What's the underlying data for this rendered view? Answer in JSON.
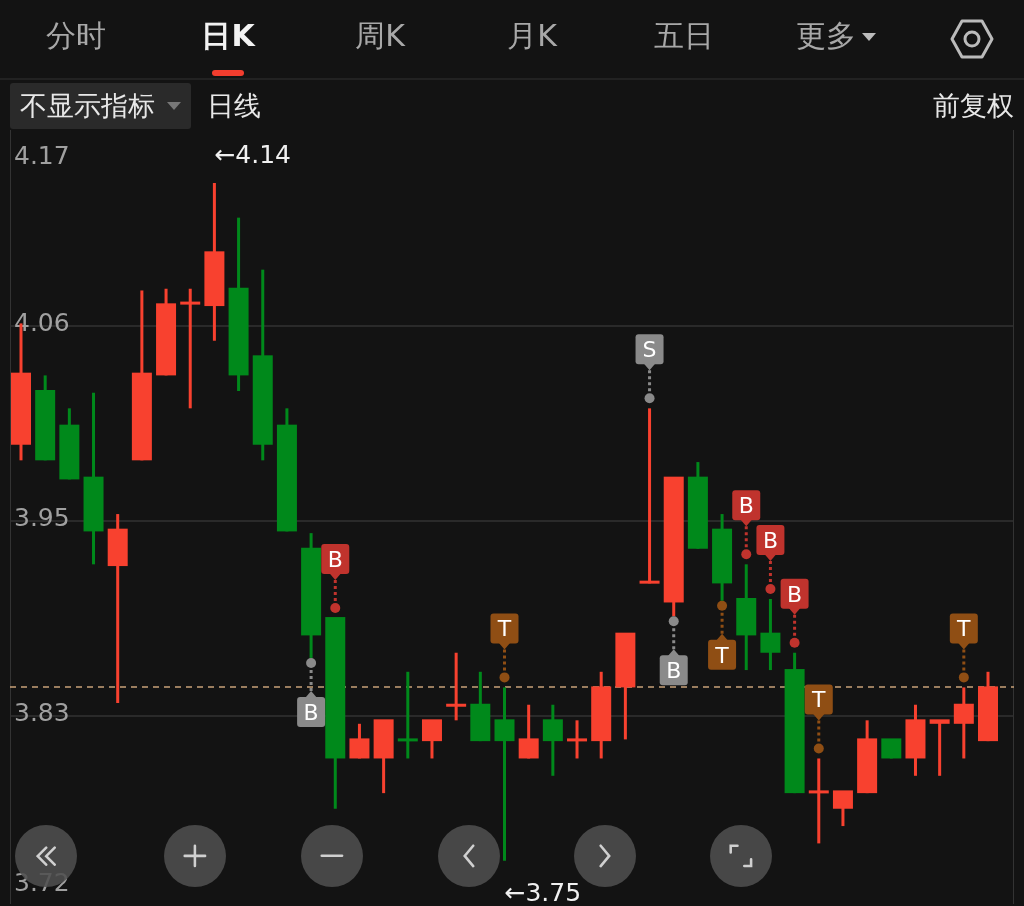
{
  "tabs": [
    {
      "label": "分时",
      "selected": false,
      "kind": "tab"
    },
    {
      "label": "日K",
      "selected": true,
      "kind": "tab"
    },
    {
      "label": "周K",
      "selected": false,
      "kind": "tab"
    },
    {
      "label": "月K",
      "selected": false,
      "kind": "tab"
    },
    {
      "label": "五日",
      "selected": false,
      "kind": "tab"
    },
    {
      "label": "更多",
      "selected": false,
      "kind": "menu"
    }
  ],
  "toolbar": {
    "indicator": "不显示指标",
    "period": "日线",
    "adjustment": "前复权"
  },
  "chart": {
    "y_labels": [
      "4.17",
      "4.06",
      "3.95",
      "3.83",
      "3.72"
    ],
    "high_label": "←4.14",
    "low_label": "←3.75",
    "markers": [
      {
        "text": "B",
        "color": "#8a8a8a"
      },
      {
        "text": "B",
        "color": "#c0332d"
      },
      {
        "text": "T",
        "color": "#8f4e14"
      },
      {
        "text": "S",
        "color": "#8a8a8a"
      },
      {
        "text": "B",
        "color": "#8a8a8a"
      },
      {
        "text": "T",
        "color": "#8f4e14"
      },
      {
        "text": "B",
        "color": "#c0332d"
      },
      {
        "text": "B",
        "color": "#c0332d"
      },
      {
        "text": "B",
        "color": "#c0332d"
      },
      {
        "text": "T",
        "color": "#8f4e14"
      },
      {
        "text": "T",
        "color": "#8f4e14"
      }
    ]
  }
}
